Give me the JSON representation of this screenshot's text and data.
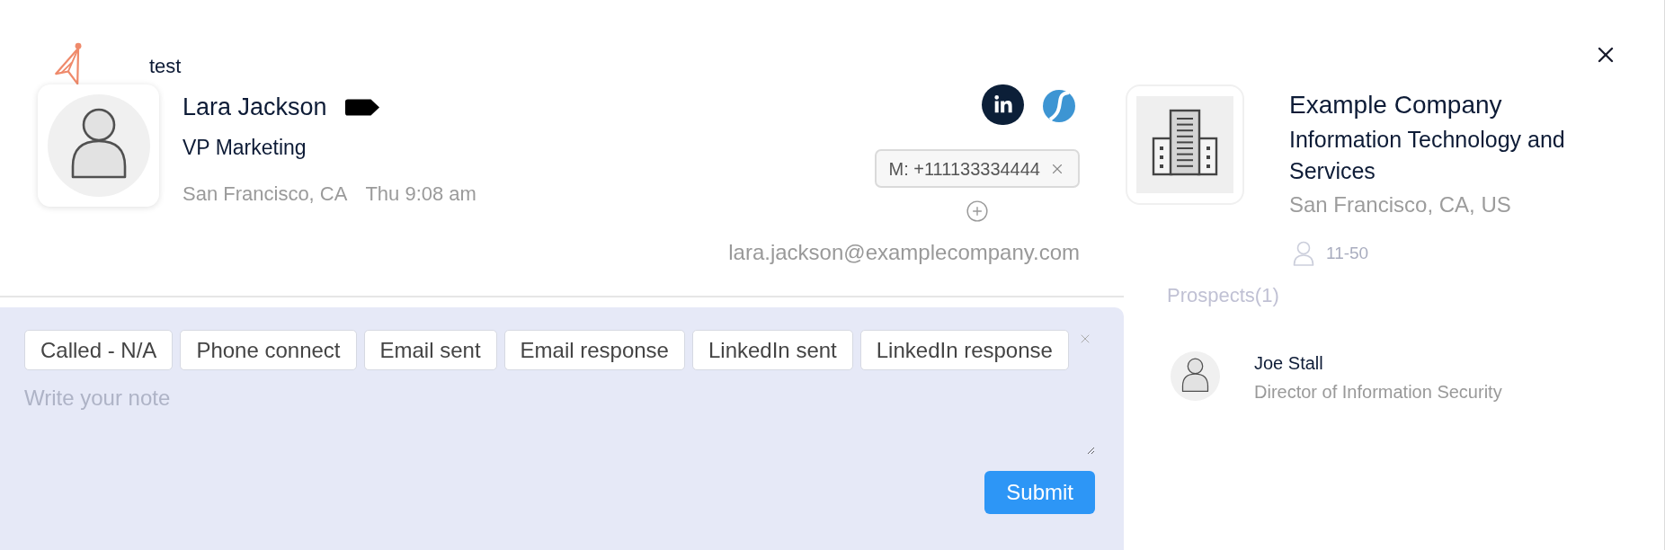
{
  "header": {
    "label": "test"
  },
  "contact": {
    "name": "Lara Jackson",
    "title": "VP Marketing",
    "location": "San Francisco, CA",
    "local_time": "Thu 9:08 am",
    "phones": [
      {
        "label": "M: +111133334444"
      }
    ],
    "email": "lara.jackson@examplecompany.com"
  },
  "note": {
    "tags": [
      {
        "label": "Called - N/A"
      },
      {
        "label": "Phone connect"
      },
      {
        "label": "Email sent"
      },
      {
        "label": "Email response"
      },
      {
        "label": "LinkedIn sent"
      },
      {
        "label": "LinkedIn response"
      }
    ],
    "placeholder": "Write your note",
    "submit": "Submit"
  },
  "company": {
    "name": "Example Company",
    "industry": "Information Technology and Services",
    "location": "San Francisco, CA, US",
    "employees": "11-50"
  },
  "prospects": {
    "title": "Prospects(1)",
    "items": [
      {
        "name": "Joe Stall",
        "title": "Director of Information Security"
      }
    ]
  }
}
